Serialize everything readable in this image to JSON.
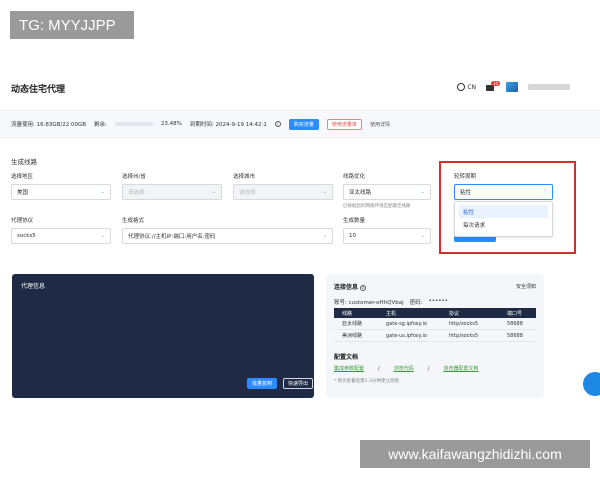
{
  "overlay": {
    "tg_text": "TG: MYYJJPP",
    "watermark": "www.kaifawangzhidizhi.com"
  },
  "header": {
    "title": "动态住宅代理",
    "lang": "CN",
    "msg_count": "10"
  },
  "stats": {
    "traffic_label": "流量使用: 16.83GB/22.00GB",
    "remaining_label": "剩余:",
    "remaining_percent": "23.48%",
    "progress_value": 0.2348,
    "expiry": "到期时间: 2024-9-19 14:42:1",
    "buy_button": "购买流量",
    "record_button": "使用流量单",
    "detail_link": "使用详情",
    "progress_color": "#4caf50"
  },
  "form": {
    "section_title": "生成线路",
    "region": {
      "label": "选择地区",
      "value": "美国"
    },
    "state": {
      "label": "选择州/省",
      "placeholder": "请选择"
    },
    "city": {
      "label": "选择城市",
      "placeholder": "请选择"
    },
    "line_opt": {
      "label": "线路优化",
      "value": "亚太线路",
      "hint": "已根据您的网络环境匹配最佳线路"
    },
    "rotation": {
      "label": "轮转周期",
      "value": "粘性",
      "options": [
        "粘性",
        "每次请求"
      ]
    },
    "protocol": {
      "label": "代理协议",
      "value": "socks5"
    },
    "format": {
      "label": "生成格式",
      "value": "代理协议://主机IP:端口:用户名:密码"
    },
    "quantity": {
      "label": "生成数量",
      "value": "10"
    }
  },
  "proxy_panel": {
    "title": "代理信息",
    "copy_button": "批量复制",
    "export_button": "快速导出"
  },
  "connection": {
    "title": "连接信息",
    "guide": "安全须知",
    "account": "账号: customer-eHhQVbaj",
    "password_label": "密码:",
    "password_value": "••••••",
    "table": {
      "headers": [
        "线路",
        "主机",
        "协议",
        "端口号"
      ],
      "rows": [
        [
          "亚太线路",
          "gate-sg.ipfoxy.io",
          "http/socks5",
          "58688"
        ],
        [
          "美洲线路",
          "gate-us.ipfoxy.io",
          "http/socks5",
          "58688"
        ]
      ]
    },
    "doc_title": "配置文档",
    "doc_links": [
      "集成参数配置",
      "浏览代码",
      "浏览器配置文档"
    ],
    "doc_separator": "/",
    "doc_note": "* 购买套餐后需1-3分钟建立链接"
  },
  "colors": {
    "accent": "#2b8cff",
    "dark_panel": "#1f2a44",
    "highlight": "#d62d2d"
  }
}
